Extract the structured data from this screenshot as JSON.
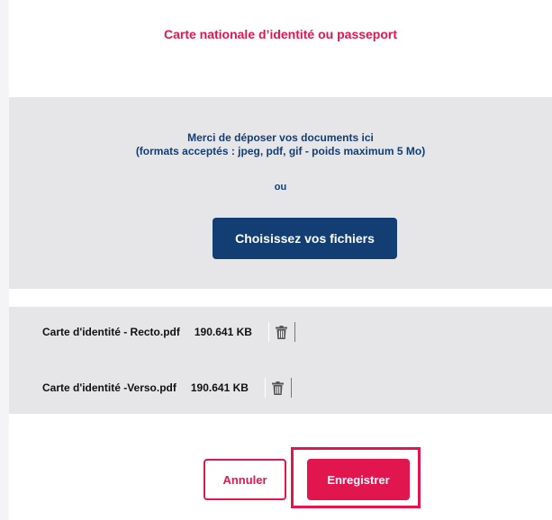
{
  "header": {
    "title": "Carte nationale d’identité ou passeport"
  },
  "dropzone": {
    "message_line1": "Merci de déposer vos documents ici",
    "message_line2": "(formats acceptés : jpeg, pdf, gif - poids maximum 5 Mo)",
    "or_label": "ou",
    "choose_label": "Choisissez vos fichiers"
  },
  "files": [
    {
      "name": "Carte d'identité - Recto.pdf",
      "size": "190.641 KB",
      "delete_icon": "trash-icon"
    },
    {
      "name": "Carte d'identité -Verso.pdf",
      "size": "190.641 KB",
      "delete_icon": "trash-icon"
    }
  ],
  "actions": {
    "cancel_label": "Annuler",
    "save_label": "Enregistrer"
  },
  "colors": {
    "accent": "#e2164f",
    "primary": "#123e74",
    "panel_gray": "#e6e6e9"
  }
}
